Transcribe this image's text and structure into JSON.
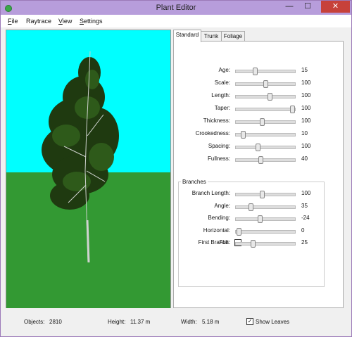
{
  "window": {
    "title": "Plant Editor",
    "min_glyph": "—",
    "max_glyph": "☐",
    "close_glyph": "✕"
  },
  "menu": {
    "items": [
      {
        "first": "F",
        "rest": "ile"
      },
      {
        "first": "",
        "rest": "Raytrace"
      },
      {
        "first": "V",
        "rest": "iew"
      },
      {
        "first": "S",
        "rest": "ettings"
      }
    ]
  },
  "tabs": [
    "Standard",
    "Trunk",
    "Foliage"
  ],
  "active_tab": "Standard",
  "standard": {
    "sliders": [
      {
        "label": "Age:",
        "value": "15",
        "pos": 0.32
      },
      {
        "label": "Scale:",
        "value": "100",
        "pos": 0.5
      },
      {
        "label": "Length:",
        "value": "100",
        "pos": 0.58
      },
      {
        "label": "Taper:",
        "value": "100",
        "pos": 0.99
      },
      {
        "label": "Thickness:",
        "value": "100",
        "pos": 0.44
      },
      {
        "label": "Crookedness:",
        "value": "10",
        "pos": 0.1
      },
      {
        "label": "Spacing:",
        "value": "100",
        "pos": 0.37
      },
      {
        "label": "Fullness:",
        "value": "40",
        "pos": 0.42
      }
    ],
    "branches": {
      "title": "Branches",
      "sliders": [
        {
          "label": "Branch Length:",
          "value": "100",
          "pos": 0.44
        },
        {
          "label": "Angle:",
          "value": "35",
          "pos": 0.24
        },
        {
          "label": "Bending:",
          "value": "-24",
          "pos": 0.4
        },
        {
          "label": "Horizontal:",
          "value": "0",
          "pos": 0.02
        },
        {
          "label": "First Branch:",
          "value": "25",
          "pos": 0.28
        }
      ],
      "flat_label": "Flat:",
      "flat_checked": false
    }
  },
  "status": {
    "objects_label": "Objects:",
    "objects_value": "2810",
    "height_label": "Height:",
    "height_value": "11.37 m",
    "width_label": "Width:",
    "width_value": "5.18 m",
    "show_leaves_label": "Show Leaves",
    "show_leaves_checked": true
  },
  "colors": {
    "sky": "#00ffff",
    "ground": "#339933",
    "title_bar": "#b79ddb",
    "close": "#c7413a"
  }
}
